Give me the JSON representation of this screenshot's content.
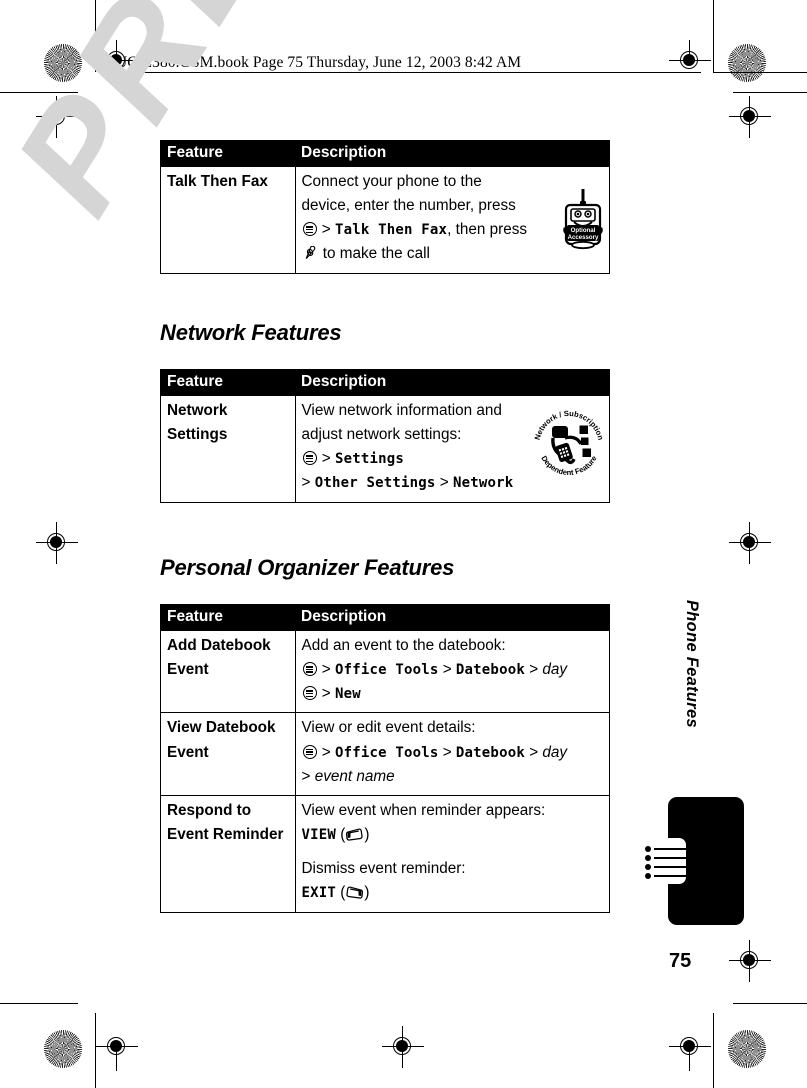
{
  "header": {
    "book_line": "UG.E380.GSM.book  Page 75  Thursday, June 12, 2003  8:42 AM"
  },
  "watermark": {
    "text": "PRELIMINARY",
    "color": "#d5d5d5"
  },
  "side_tab": {
    "title": "Phone Features",
    "page_number": "75",
    "icon": "bulleted-list-icon"
  },
  "tables": [
    {
      "id": "fax-features-table",
      "headers": {
        "feature": "Feature",
        "description": "Description"
      },
      "rows": [
        {
          "feature": "Talk Then Fax",
          "icon": "optional-accessory-icon",
          "lines": [
            {
              "segments": [
                {
                  "type": "text",
                  "text": "Connect your phone to the device, enter the number, press "
                },
                {
                  "type": "glyph",
                  "glyph": "menu-key-icon"
                },
                {
                  "type": "text",
                  "text": " > "
                },
                {
                  "type": "mono",
                  "text": "Talk Then Fax"
                },
                {
                  "type": "text",
                  "text": ", then press "
                },
                {
                  "type": "glyph",
                  "glyph": "send-key-icon"
                },
                {
                  "type": "text",
                  "text": " to make the call"
                }
              ]
            }
          ]
        }
      ]
    },
    {
      "id": "network-features-table",
      "headers": {
        "feature": "Feature",
        "description": "Description"
      },
      "rows": [
        {
          "feature": "Network Settings",
          "icon": "network-subscription-dependent-feature-icon",
          "lines": [
            {
              "segments": [
                {
                  "type": "text",
                  "text": "View network information and adjust network settings:"
                }
              ]
            },
            {
              "segments": [
                {
                  "type": "glyph",
                  "glyph": "menu-key-icon"
                },
                {
                  "type": "text",
                  "text": " > "
                },
                {
                  "type": "mono",
                  "text": "Settings"
                }
              ]
            },
            {
              "segments": [
                {
                  "type": "text",
                  "text": "> "
                },
                {
                  "type": "mono",
                  "text": "Other Settings"
                },
                {
                  "type": "text",
                  "text": " > "
                },
                {
                  "type": "mono",
                  "text": "Network"
                }
              ]
            }
          ]
        }
      ]
    },
    {
      "id": "personal-organizer-table",
      "headers": {
        "feature": "Feature",
        "description": "Description"
      },
      "rows": [
        {
          "feature": "Add Datebook Event",
          "lines": [
            {
              "segments": [
                {
                  "type": "text",
                  "text": "Add an event to the datebook:"
                }
              ]
            },
            {
              "segments": [
                {
                  "type": "glyph",
                  "glyph": "menu-key-icon"
                },
                {
                  "type": "text",
                  "text": " > "
                },
                {
                  "type": "mono",
                  "text": "Office Tools"
                },
                {
                  "type": "text",
                  "text": " > "
                },
                {
                  "type": "mono",
                  "text": "Datebook"
                },
                {
                  "type": "text",
                  "text": " > "
                },
                {
                  "type": "italic",
                  "text": "day"
                }
              ]
            },
            {
              "segments": [
                {
                  "type": "glyph",
                  "glyph": "menu-key-icon"
                },
                {
                  "type": "text",
                  "text": " > "
                },
                {
                  "type": "mono",
                  "text": "New"
                }
              ]
            }
          ]
        },
        {
          "feature": "View Datebook Event",
          "lines": [
            {
              "segments": [
                {
                  "type": "text",
                  "text": "View or edit event details:"
                }
              ]
            },
            {
              "segments": [
                {
                  "type": "glyph",
                  "glyph": "menu-key-icon"
                },
                {
                  "type": "text",
                  "text": " > "
                },
                {
                  "type": "mono",
                  "text": "Office Tools"
                },
                {
                  "type": "text",
                  "text": " > "
                },
                {
                  "type": "mono",
                  "text": "Datebook"
                },
                {
                  "type": "text",
                  "text": " > "
                },
                {
                  "type": "italic",
                  "text": "day"
                }
              ]
            },
            {
              "segments": [
                {
                  "type": "text",
                  "text": "> "
                },
                {
                  "type": "italic",
                  "text": "event name"
                }
              ]
            }
          ]
        },
        {
          "feature": "Respond to Event Reminder",
          "lines": [
            {
              "segments": [
                {
                  "type": "text",
                  "text": "View event when reminder appears:"
                }
              ]
            },
            {
              "segments": [
                {
                  "type": "mono",
                  "text": "VIEW"
                },
                {
                  "type": "text",
                  "text": " ("
                },
                {
                  "type": "glyph",
                  "glyph": "left-soft-key-icon"
                },
                {
                  "type": "text",
                  "text": ")"
                }
              ]
            },
            {
              "segments": [
                {
                  "type": "spacer"
                }
              ]
            },
            {
              "segments": [
                {
                  "type": "text",
                  "text": "Dismiss event reminder:"
                }
              ]
            },
            {
              "segments": [
                {
                  "type": "mono",
                  "text": "EXIT"
                },
                {
                  "type": "text",
                  "text": " ("
                },
                {
                  "type": "glyph",
                  "glyph": "right-soft-key-icon"
                },
                {
                  "type": "text",
                  "text": ")"
                }
              ]
            }
          ]
        }
      ]
    }
  ],
  "sections": [
    {
      "id": "network-features-heading",
      "title": "Network Features"
    },
    {
      "id": "personal-organizer-heading",
      "title": "Personal Organizer Features"
    }
  ],
  "icons": {
    "optional_accessory_label_line1": "Optional",
    "optional_accessory_label_line2": "Accessory",
    "network_badge_top": "Network / Subscription",
    "network_badge_bottom": "Dependent  Feature"
  }
}
